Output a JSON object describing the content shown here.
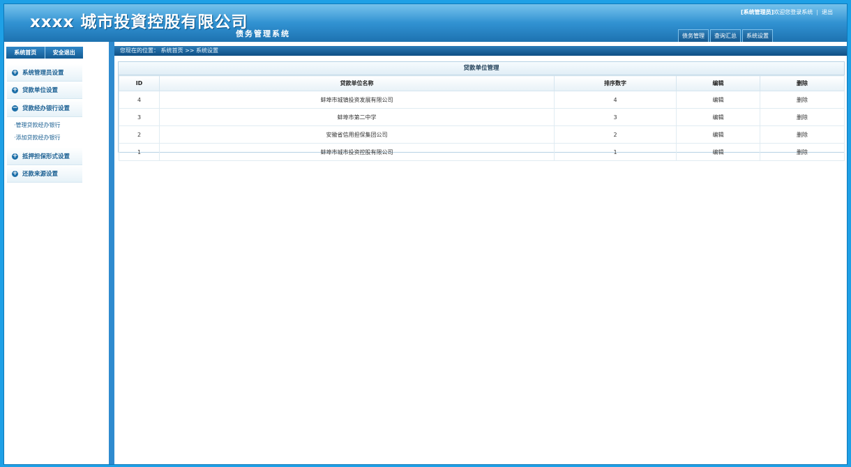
{
  "header": {
    "title": "xxxx 城市投資控股有限公司",
    "subtitle": "债务管理系统",
    "user": "[系统管理员]",
    "welcome": "欢迎您登录系统",
    "logout": "退出",
    "nav": [
      "债务管理",
      "查询汇总",
      "系统设置"
    ]
  },
  "left": {
    "tabs": [
      "系统首页",
      "安全退出"
    ],
    "menu": [
      "系统管理员设置",
      "贷款单位设置",
      "贷款经办银行设置",
      "抵押担保形式设置",
      "还款来源设置"
    ],
    "sub": [
      "·管理贷款经办银行",
      "·添加贷款经办银行"
    ]
  },
  "breadcrumb": "您现在的位置： 系统首页 >> 系统设置",
  "panel": {
    "title": "贷款单位管理",
    "columns": [
      "ID",
      "贷款单位名称",
      "排序数字",
      "编辑",
      "删除"
    ],
    "rows": [
      {
        "id": "4",
        "name": "蚌埠市城镇投资发展有限公司",
        "order": "4",
        "edit": "编辑",
        "del": "删除"
      },
      {
        "id": "3",
        "name": "蚌埠市第二中学",
        "order": "3",
        "edit": "编辑",
        "del": "删除"
      },
      {
        "id": "2",
        "name": "安徽省信用担保集团公司",
        "order": "2",
        "edit": "编辑",
        "del": "删除"
      },
      {
        "id": "1",
        "name": "蚌埠市城市投资控股有限公司",
        "order": "1",
        "edit": "编辑",
        "del": "删除"
      }
    ]
  }
}
